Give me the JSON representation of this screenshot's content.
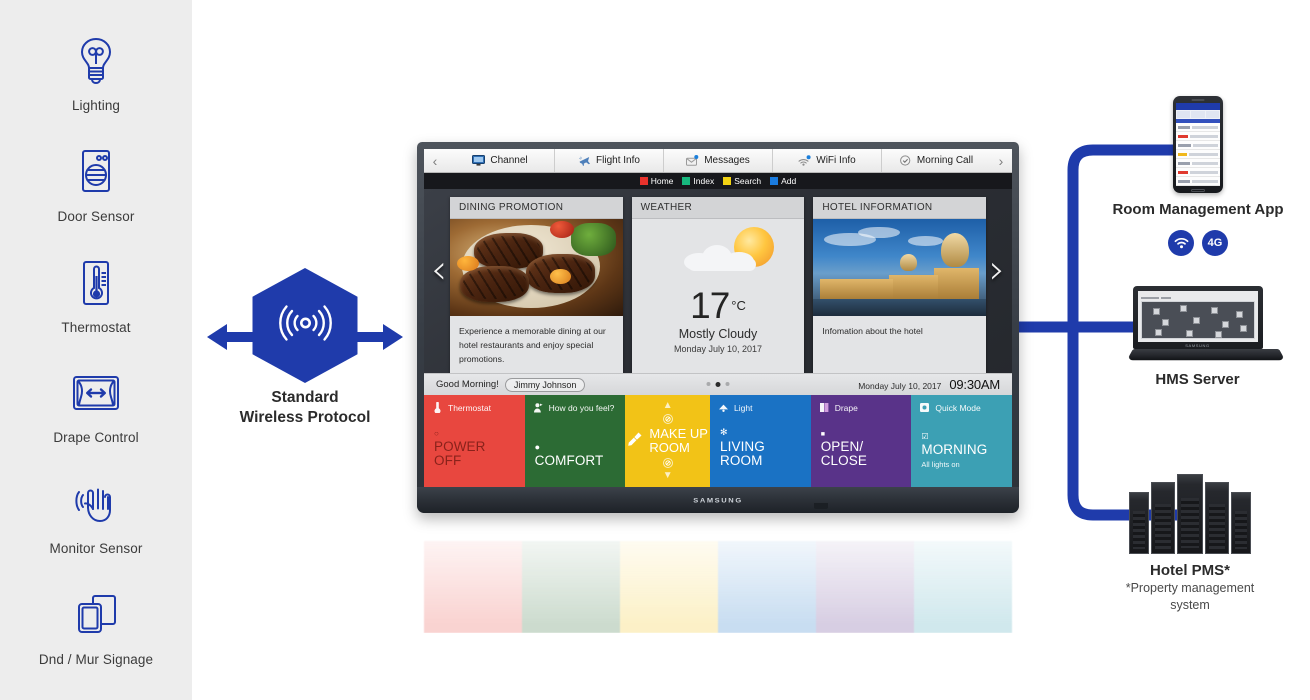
{
  "sidebar": {
    "items": [
      {
        "label": "Lighting",
        "icon": "lightbulb-icon"
      },
      {
        "label": "Door Sensor",
        "icon": "door-sensor-icon"
      },
      {
        "label": "Thermostat",
        "icon": "thermostat-icon"
      },
      {
        "label": "Drape Control",
        "icon": "drape-control-icon"
      },
      {
        "label": "Monitor Sensor",
        "icon": "hand-motion-sensor-icon"
      },
      {
        "label": "Dnd / Mur Signage",
        "icon": "dnd-signage-icon"
      }
    ]
  },
  "hub": {
    "icon": "wireless-signal-icon",
    "caption_line1": "Standard",
    "caption_line2": "Wireless Protocol",
    "color": "#1f3bab"
  },
  "tv": {
    "brand": "SAMSUNG",
    "nav": {
      "prev": "‹",
      "next": "›",
      "items": [
        {
          "label": "Channel",
          "icon": "monitor-icon"
        },
        {
          "label": "Flight Info",
          "icon": "airplane-icon"
        },
        {
          "label": "Messages",
          "icon": "envelope-icon"
        },
        {
          "label": "WiFi Info",
          "icon": "wifi-icon"
        },
        {
          "label": "Morning Call",
          "icon": "clock-icon"
        }
      ]
    },
    "color_keys": [
      {
        "label": "Home",
        "color": "#e8322c"
      },
      {
        "label": "Index",
        "color": "#17b87e"
      },
      {
        "label": "Search",
        "color": "#f2d313"
      },
      {
        "label": "Add",
        "color": "#1a7ce0"
      }
    ],
    "cards": [
      {
        "title": "DINING PROMOTION",
        "text": "Experience a memorable dining at our hotel restaurants and enjoy special promotions.",
        "image": "grilled-steak-photo"
      },
      {
        "title": "WEATHER",
        "temperature": "17",
        "unit": "°C",
        "condition": "Mostly Cloudy",
        "date": "Monday July 10, 2017",
        "image": "sun-behind-cloud-icon"
      },
      {
        "title": "HOTEL INFORMATION",
        "text": "Infomation about the hotel",
        "image": "city-skyline-night-photo"
      }
    ],
    "carousel": {
      "prev": "‹",
      "next": "›",
      "page_count": 3,
      "active_page": 2
    },
    "greeting": {
      "text": "Good Morning!",
      "guest_name": "Jimmy Johnson",
      "date": "Monday July 10, 2017",
      "time": "09:30AM"
    },
    "tiles": [
      {
        "header": "Thermostat",
        "header_icon": "thermometer-icon",
        "bullet": "○",
        "title": "POWER\nOFF",
        "sub": "",
        "color": "#e8473f",
        "text_color": "#7c1914"
      },
      {
        "header": "How do you feel?",
        "header_icon": "person-comfort-icon",
        "bullet": "●",
        "title": "COMFORT",
        "sub": "",
        "color": "#2c6b34",
        "text_color": "#ffffff"
      },
      {
        "header": "",
        "header_icon": "broom-icon",
        "bullet": "",
        "title": "MAKE UP\nROOM",
        "sub": "",
        "color": "#f2c317",
        "text_color": "#ffffff"
      },
      {
        "header": "Light",
        "header_icon": "lamp-icon",
        "bullet": "✻",
        "title": "LIVING\nROOM",
        "sub": "",
        "color": "#1a72c4",
        "text_color": "#ffffff"
      },
      {
        "header": "Drape",
        "header_icon": "drape-icon",
        "bullet": "■",
        "title": "OPEN/\nCLOSE",
        "sub": "",
        "color": "#593389",
        "text_color": "#ffffff"
      },
      {
        "header": "Quick Mode",
        "header_icon": "quick-mode-icon",
        "bullet": "☑",
        "title": "MORNING",
        "sub": "All lights on",
        "color": "#3ca0b4",
        "text_color": "#ffffff"
      }
    ]
  },
  "devices": {
    "phone": {
      "caption": "Room Management App",
      "image": "smartphone-room-list"
    },
    "connectivity": [
      {
        "label": "",
        "icon": "wifi-icon"
      },
      {
        "label": "4G",
        "icon": "4g-icon"
      }
    ],
    "server": {
      "caption": "HMS Server",
      "image": "laptop-network-map"
    },
    "pms": {
      "caption": "Hotel PMS*",
      "sub_line1": "*Property management",
      "sub_line2": "system",
      "image": "server-racks"
    }
  },
  "theme": {
    "brand_blue": "#1f3bab",
    "sidebar_bg": "#ededed",
    "page_bg": "#ffffff"
  }
}
